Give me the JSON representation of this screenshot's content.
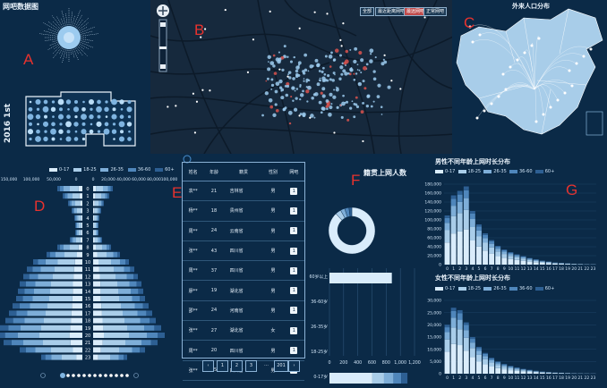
{
  "app_title": "网吧数据图",
  "side_year": "2016 1st",
  "panel_labels": {
    "a": "A",
    "b": "B",
    "c": "C",
    "d": "D",
    "e": "E",
    "f": "F",
    "g": "G"
  },
  "map_legend": [
    "全部",
    "最近距离网吧",
    "最远网吧",
    "正常网吧"
  ],
  "china_map_title": "外来人口分布",
  "age_groups": [
    "0-17",
    "18-25",
    "26-35",
    "36-60",
    "60+"
  ],
  "colors": {
    "g1": "#d9ecfb",
    "g2": "#a9cde9",
    "g3": "#7eaed8",
    "g4": "#4f86bb",
    "g5": "#2d5f93"
  },
  "pyramid": {
    "left_axis": [
      "150,000",
      "100,000",
      "50,000",
      "0"
    ],
    "right_axis": [
      "0",
      "20,000",
      "40,000",
      "60,000",
      "80,000",
      "100,000"
    ],
    "hours": [
      "0",
      "1",
      "2",
      "3",
      "4",
      "5",
      "6",
      "7",
      "8",
      "9",
      "10",
      "11",
      "12",
      "13",
      "14",
      "15",
      "16",
      "17",
      "18",
      "19",
      "20",
      "21",
      "22",
      "23"
    ],
    "left_values": [
      28,
      22,
      16,
      12,
      9,
      8,
      8,
      14,
      28,
      40,
      55,
      62,
      66,
      70,
      72,
      74,
      78,
      82,
      86,
      92,
      96,
      88,
      70,
      46
    ],
    "right_values": [
      22,
      18,
      12,
      9,
      7,
      6,
      6,
      10,
      20,
      30,
      40,
      46,
      50,
      54,
      56,
      58,
      62,
      66,
      70,
      76,
      80,
      72,
      58,
      38
    ]
  },
  "table": {
    "headers": [
      "姓名",
      "年龄",
      "籍贯",
      "性别",
      "网吧"
    ],
    "rows": [
      {
        "name": "袁**",
        "age": "21",
        "origin": "吉林省",
        "sex": "男"
      },
      {
        "name": "杨**",
        "age": "18",
        "origin": "贵州省",
        "sex": "男"
      },
      {
        "name": "周**",
        "age": "24",
        "origin": "云南省",
        "sex": "男"
      },
      {
        "name": "张**",
        "age": "43",
        "origin": "四川省",
        "sex": "男"
      },
      {
        "name": "周**",
        "age": "37",
        "origin": "四川省",
        "sex": "男"
      },
      {
        "name": "廖**",
        "age": "19",
        "origin": "湖北省",
        "sex": "男"
      },
      {
        "name": "邵**",
        "age": "24",
        "origin": "河南省",
        "sex": "男"
      },
      {
        "name": "张**",
        "age": "27",
        "origin": "湖北省",
        "sex": "女"
      },
      {
        "name": "周**",
        "age": "20",
        "origin": "四川省",
        "sex": "男"
      },
      {
        "name": "张**",
        "age": "25",
        "origin": "四川省",
        "sex": "男"
      }
    ],
    "cell_button": "1",
    "pages": [
      "‹",
      "1",
      "2",
      "3",
      "…",
      "201",
      "›"
    ]
  },
  "f_title": "籍贯上网人数",
  "f_bars": {
    "categories": [
      "60岁以上",
      "36-60岁",
      "26-35岁",
      "18-25岁",
      "0-17岁"
    ],
    "values": [
      880,
      0,
      0,
      0,
      1100
    ],
    "axis": [
      "0",
      "200",
      "400",
      "600",
      "800",
      "1,000",
      "1,200"
    ]
  },
  "g1_title": "男性不同年龄上网时长分布",
  "g1_axis": [
    "180,000",
    "160,000",
    "140,000",
    "120,000",
    "100,000",
    "80,000",
    "60,000",
    "40,000",
    "20,000",
    "0"
  ],
  "g1_values": [
    110000,
    155000,
    165000,
    175000,
    120000,
    90000,
    70000,
    55000,
    42000,
    34000,
    28000,
    23000,
    19000,
    15000,
    12000,
    9000,
    7000,
    5000,
    4000,
    3000,
    2000,
    1500,
    1000,
    800
  ],
  "g2_title": "女性不同年龄上网时长分布",
  "g2_axis": [
    "30,000",
    "25,000",
    "20,000",
    "15,000",
    "10,000",
    "5,000",
    "0"
  ],
  "g2_values": [
    20000,
    27000,
    26000,
    21000,
    15000,
    11000,
    8500,
    6500,
    5000,
    4000,
    3200,
    2500,
    2000,
    1600,
    1200,
    900,
    700,
    500,
    400,
    300,
    200,
    150,
    100,
    80
  ],
  "hours_x": [
    "0",
    "1",
    "2",
    "3",
    "4",
    "5",
    "6",
    "7",
    "8",
    "9",
    "10",
    "11",
    "12",
    "13",
    "14",
    "15",
    "16",
    "17",
    "18",
    "19",
    "20",
    "21",
    "22",
    "23"
  ]
}
